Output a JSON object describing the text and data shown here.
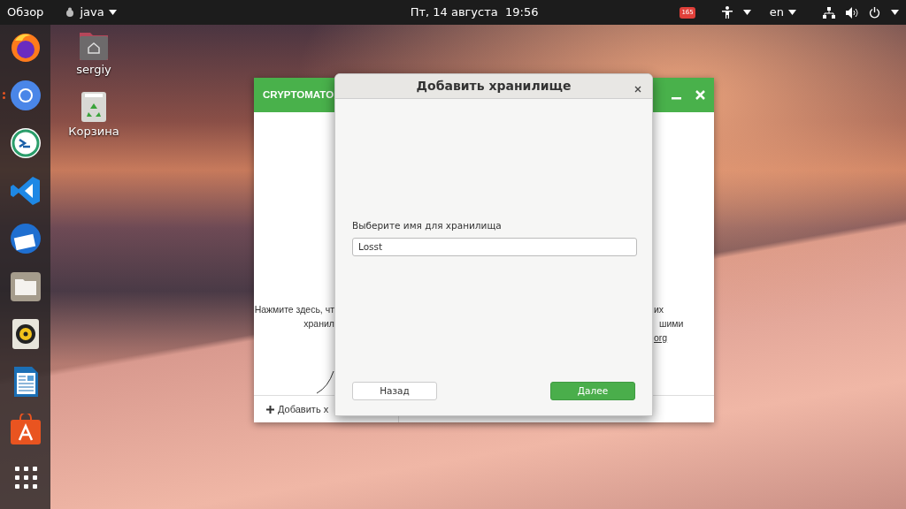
{
  "top_bar": {
    "activities": "Обзор",
    "app_menu": "java",
    "clock": "Пт, 14 августа  19:56",
    "indicator_badge": "165",
    "keyboard_layout": "en"
  },
  "dock": {
    "apps": [
      {
        "kind": "firefox",
        "running": false
      },
      {
        "kind": "chromium",
        "running": true
      },
      {
        "kind": "remmina",
        "running": false
      },
      {
        "kind": "vscode",
        "running": false
      },
      {
        "kind": "thunderbird",
        "running": false
      },
      {
        "kind": "files",
        "running": false
      },
      {
        "kind": "rhythmbox",
        "running": false
      },
      {
        "kind": "writer",
        "running": false
      },
      {
        "kind": "software",
        "running": false
      },
      {
        "kind": "grid",
        "running": false
      }
    ]
  },
  "desktop_icons": [
    {
      "kind": "home",
      "label": "sergiy"
    },
    {
      "kind": "trash",
      "label": "Корзина"
    }
  ],
  "background_window": {
    "title": "CRYPTOMATO",
    "left_lines": [
      "Нажмите здесь, чт",
      "хранил"
    ],
    "right_lines": [
      {
        "kind": "text",
        "text": "их"
      },
      {
        "kind": "text",
        "text": "шими"
      },
      {
        "kind": "link",
        "text": "org"
      }
    ],
    "add_button": "Добавить х"
  },
  "dialog": {
    "title": "Добавить хранилище",
    "field_label": "Выберите имя для хранилища",
    "field_value": "Losst",
    "buttons": [
      {
        "label": "Назад",
        "primary": false
      },
      {
        "label": "Далее",
        "primary": true
      }
    ]
  }
}
